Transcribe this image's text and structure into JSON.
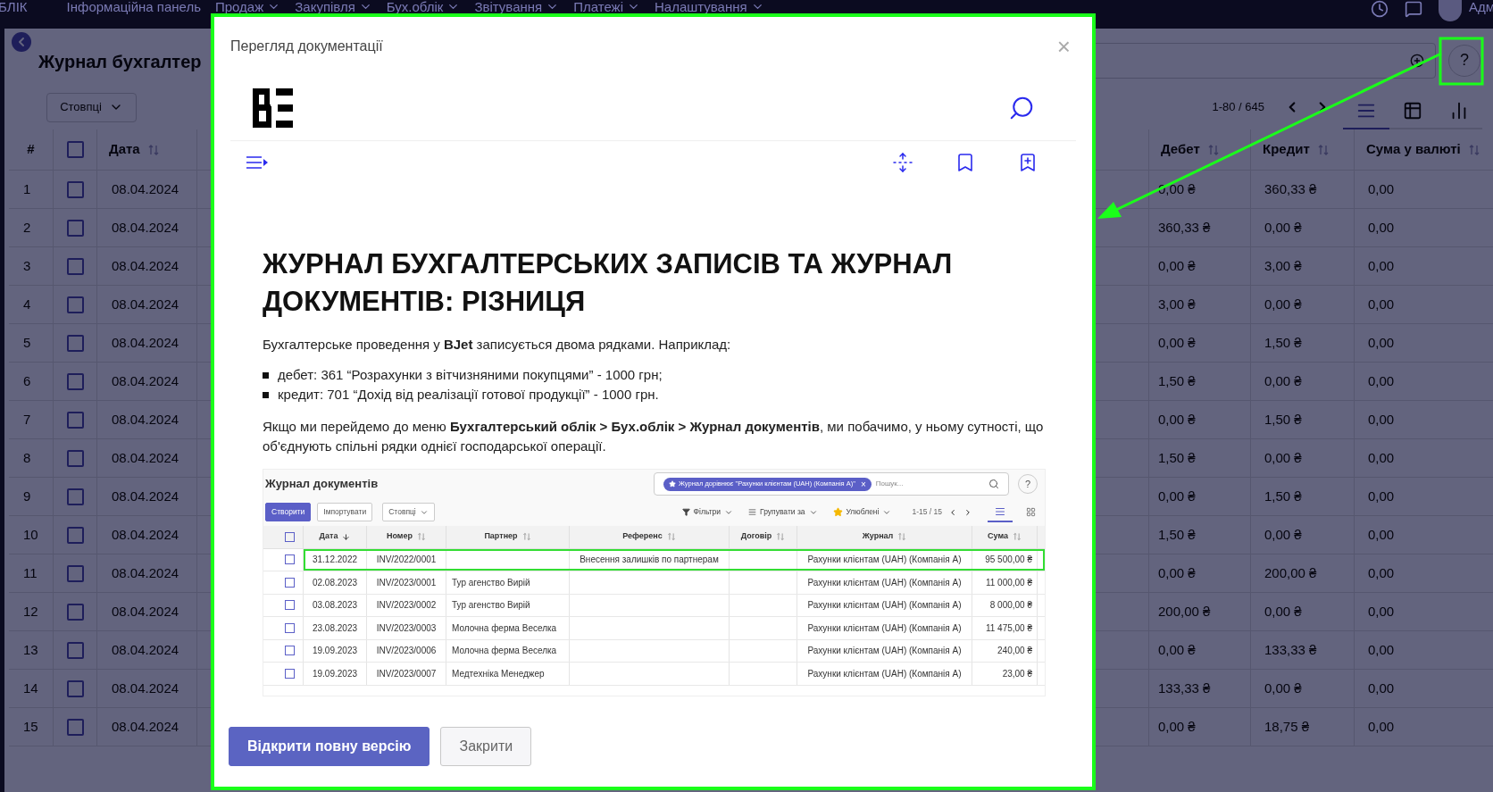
{
  "nav": {
    "brand": "БЛІК",
    "items": [
      {
        "label": "Інформаційна панель",
        "dropdown": false
      },
      {
        "label": "Продаж",
        "dropdown": true
      },
      {
        "label": "Закупівля",
        "dropdown": true
      },
      {
        "label": "Бух.облік",
        "dropdown": true
      },
      {
        "label": "Звітування",
        "dropdown": true
      },
      {
        "label": "Платежі",
        "dropdown": true
      },
      {
        "label": "Налаштування",
        "dropdown": true
      }
    ],
    "user": "Адм"
  },
  "page": {
    "title": "Журнал бухгалтер",
    "columns_button": "Стовпці",
    "help": "?",
    "pager": "1-80 / 645",
    "views": [
      {
        "kind": "list",
        "selected": true
      },
      {
        "kind": "table",
        "selected": false
      },
      {
        "kind": "chart",
        "selected": false
      }
    ]
  },
  "table": {
    "columns": [
      {
        "label": "#",
        "sortable": false
      },
      {
        "label": "Дата",
        "sortable": true
      },
      {
        "label": "Дебет",
        "sortable": true
      },
      {
        "label": "Кредит",
        "sortable": true
      },
      {
        "label": "Сума у валюті",
        "sortable": true
      }
    ],
    "all_checked": false,
    "rows": [
      {
        "n": "1",
        "date": "08.04.2024",
        "debit": "0,00 ₴",
        "credit": "360,33 ₴",
        "currency": "0,00",
        "checked": false
      },
      {
        "n": "2",
        "date": "08.04.2024",
        "debit": "360,33 ₴",
        "credit": "0,00 ₴",
        "currency": "0,00",
        "checked": false
      },
      {
        "n": "3",
        "date": "08.04.2024",
        "debit": "0,00 ₴",
        "credit": "3,00 ₴",
        "currency": "0,00",
        "checked": false
      },
      {
        "n": "4",
        "date": "08.04.2024",
        "debit": "3,00 ₴",
        "credit": "0,00 ₴",
        "currency": "0,00",
        "checked": false
      },
      {
        "n": "5",
        "date": "08.04.2024",
        "debit": "0,00 ₴",
        "credit": "1,50 ₴",
        "currency": "0,00",
        "checked": false
      },
      {
        "n": "6",
        "date": "08.04.2024",
        "debit": "1,50 ₴",
        "credit": "0,00 ₴",
        "currency": "0,00",
        "checked": false
      },
      {
        "n": "7",
        "date": "08.04.2024",
        "debit": "0,00 ₴",
        "credit": "1,50 ₴",
        "currency": "0,00",
        "checked": false
      },
      {
        "n": "8",
        "date": "08.04.2024",
        "debit": "1,50 ₴",
        "credit": "0,00 ₴",
        "currency": "0,00",
        "checked": false
      },
      {
        "n": "9",
        "date": "08.04.2024",
        "debit": "0,00 ₴",
        "credit": "1,50 ₴",
        "currency": "0,00",
        "checked": false
      },
      {
        "n": "10",
        "date": "08.04.2024",
        "debit": "1,50 ₴",
        "credit": "0,00 ₴",
        "currency": "0,00",
        "checked": false
      },
      {
        "n": "11",
        "date": "08.04.2024",
        "debit": "0,00 ₴",
        "credit": "200,00 ₴",
        "currency": "0,00",
        "checked": false
      },
      {
        "n": "12",
        "date": "08.04.2024",
        "debit": "200,00 ₴",
        "credit": "0,00 ₴",
        "currency": "0,00",
        "checked": false
      },
      {
        "n": "13",
        "date": "08.04.2024",
        "debit": "0,00 ₴",
        "credit": "133,33 ₴",
        "currency": "0,00",
        "checked": false
      },
      {
        "n": "14",
        "date": "08.04.2024",
        "debit": "133,33 ₴",
        "credit": "0,00 ₴",
        "currency": "0,00",
        "checked": false
      },
      {
        "n": "15",
        "date": "08.04.2024",
        "debit": "0,00 ₴",
        "credit": "18,75 ₴",
        "currency": "0,00",
        "checked": false
      }
    ]
  },
  "dialog": {
    "title": "Перегляд документації",
    "close": "×",
    "doc": {
      "heading": "ЖУРНАЛ БУХГАЛТЕРСЬКИХ ЗАПИСІВ ТА ЖУРНАЛ ДОКУМЕНТІВ: РІЗНИЦЯ",
      "intro": "Бухгалтерське проведення у **BJet** записується двома рядками. Наприклад:",
      "bullets": [
        "дебет: 361 “Розрахунки з вітчизняними покупцями” - 1000 грн;",
        "кредит: 701 “Дохід від реалізації готової продукції” - 1000 грн."
      ],
      "para": "Якщо ми перейдемо до меню **Бухгалтерський облік > Бух.облік > Журнал документів**, ми побачимо, у ньому сутності, що об'єднують спільні рядки однієї господарської операції.",
      "screenshot": {
        "title": "Журнал документів",
        "chip": "Журнал дорівнює \"Рахунки клієнтам (UAH) (Компанія А)\"",
        "chip_close": "×",
        "search_placeholder": "Пошук...",
        "help": "?",
        "buttons": [
          {
            "label": "Створити",
            "kind": "primary"
          },
          {
            "label": "Імпортувати",
            "kind": "secondary"
          },
          {
            "label": "Стовпці",
            "kind": "dropdown"
          }
        ],
        "filters": "Фільтри",
        "group_by": "Групувати за",
        "favorites": "Улюблені",
        "pager": "1-15 / 15",
        "all_checked": false,
        "columns": [
          {
            "label": "Дата",
            "sorted_desc": true
          },
          {
            "label": "Номер",
            "sorted_desc": false
          },
          {
            "label": "Партнер",
            "sorted_desc": false
          },
          {
            "label": "Референс",
            "sorted_desc": false
          },
          {
            "label": "Договір",
            "sorted_desc": false
          },
          {
            "label": "Журнал",
            "sorted_desc": false
          },
          {
            "label": "Сума",
            "sorted_desc": false
          }
        ],
        "rows": [
          {
            "date": "31.12.2022",
            "number": "INV/2022/0001",
            "reference": "Внесення залишків по партнерам",
            "journal": "Рахунки клієнтам (UAH) (Компанія А)",
            "amount": "95 500,00 ₴",
            "highlighted": true,
            "checked": false
          },
          {
            "date": "02.08.2023",
            "number": "INV/2023/0001",
            "partner": "Тур агенство Вирій",
            "journal": "Рахунки клієнтам (UAH) (Компанія А)",
            "amount": "11 000,00 ₴",
            "highlighted": false,
            "checked": false
          },
          {
            "date": "03.08.2023",
            "number": "INV/2023/0002",
            "partner": "Тур агенство Вирій",
            "journal": "Рахунки клієнтам (UAH) (Компанія А)",
            "amount": "8 000,00 ₴",
            "highlighted": false,
            "checked": false
          },
          {
            "date": "23.08.2023",
            "number": "INV/2023/0003",
            "partner": "Молочна ферма Веселка",
            "journal": "Рахунки клієнтам (UAH) (Компанія А)",
            "amount": "11 475,00 ₴",
            "highlighted": false,
            "checked": false
          },
          {
            "date": "19.09.2023",
            "number": "INV/2023/0006",
            "partner": "Молочна ферма Веселка",
            "journal": "Рахунки клієнтам (UAH) (Компанія А)",
            "amount": "240,00 ₴",
            "highlighted": false,
            "checked": false
          },
          {
            "date": "19.09.2023",
            "number": "INV/2023/0007",
            "partner": "Медтехніка Менеджер",
            "journal": "Рахунки клієнтам (UAH) (Компанія А)",
            "amount": "23,00 ₴",
            "highlighted": false,
            "checked": false
          }
        ]
      }
    },
    "buttons": [
      {
        "label": "Відкрити повну версію",
        "kind": "primary"
      },
      {
        "label": "Закрити",
        "kind": "secondary"
      }
    ]
  }
}
